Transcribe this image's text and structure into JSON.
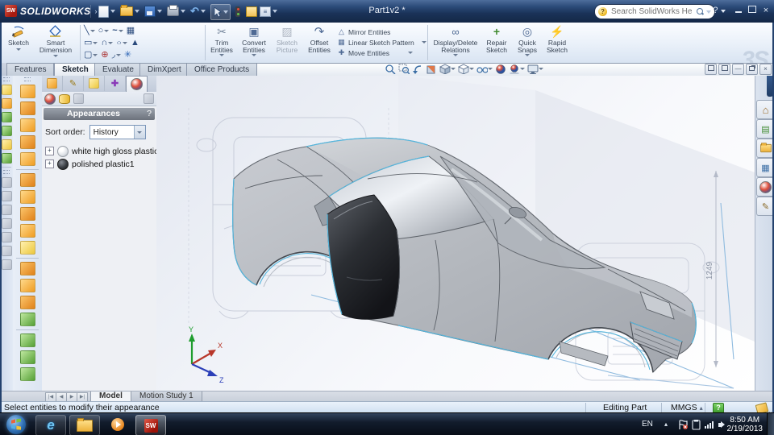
{
  "titlebar": {
    "logo_glyph": "SW",
    "brand": "SOLIDWORKS",
    "flyout_glyph": "›",
    "title": "Part1v2 *",
    "search_placeholder": "Search SolidWorks Help",
    "search_ball_glyph": "?",
    "help_glyph": "?",
    "close_glyph": "×"
  },
  "quick_access": {
    "icons": [
      "new-document",
      "open",
      "save",
      "print",
      "undo",
      "select",
      "rebuild-traffic-light",
      "file-properties",
      "options"
    ]
  },
  "ribbon": {
    "sketch": "Sketch",
    "smart_dimension": "Smart Dimension",
    "trim": "Trim Entities",
    "convert": "Convert Entities",
    "sketch_picture": "Sketch Picture",
    "offset": "Offset Entities",
    "mirror": "Mirror Entities",
    "linear_pattern": "Linear Sketch Pattern",
    "move": "Move Entities",
    "display_delete": "Display/Delete Relations",
    "repair": "Repair Sketch",
    "quick_snaps": "Quick Snaps",
    "rapid": "Rapid Sketch",
    "watermark": "3S",
    "sketch_tools": [
      {
        "name": "line",
        "glyph": "╲"
      },
      {
        "name": "circle",
        "glyph": "○"
      },
      {
        "name": "spline",
        "glyph": "~"
      },
      {
        "name": "spline-grid",
        "glyph": "▦"
      },
      {
        "name": "corner-rectangle",
        "glyph": "▭"
      },
      {
        "name": "centerpoint-arc",
        "glyph": "∩"
      },
      {
        "name": "ellipse",
        "glyph": "○"
      },
      {
        "name": "polygon",
        "glyph": "▲"
      },
      {
        "name": "straight-slot",
        "glyph": "▢"
      },
      {
        "name": "point",
        "glyph": "⊕"
      },
      {
        "name": "sketch-fillet",
        "glyph": "◞"
      },
      {
        "name": "pattern-star",
        "glyph": "✳"
      }
    ],
    "glyphs": {
      "trim": "✂",
      "convert": "▣",
      "picture": "▨",
      "offset": "↷",
      "mirror": "△",
      "linear": "▦",
      "move": "✚",
      "display": "∞",
      "repair": "+",
      "snaps": "◎",
      "rapid": "⚡"
    }
  },
  "command_tabs": {
    "tabs": [
      {
        "label": "Features",
        "active": false
      },
      {
        "label": "Sketch",
        "active": true
      },
      {
        "label": "Evaluate",
        "active": false
      },
      {
        "label": "DimXpert",
        "active": false
      },
      {
        "label": "Office Products",
        "active": false
      }
    ]
  },
  "headsup": {
    "icons": [
      "zoom-to-fit",
      "zoom-to-area",
      "zoom-previous",
      "section-view",
      "view-orientation",
      "display-style",
      "hide-show-items",
      "edit-appearance",
      "apply-scene",
      "view-settings"
    ]
  },
  "panel": {
    "tabs": [
      "feature-manager",
      "property-manager",
      "configuration-manager",
      "dimxpert-manager",
      "display-manager"
    ],
    "tab_glyphs": {
      "property": "✎",
      "dimxpert": "✚"
    },
    "subtoolbar": [
      "appearances-filter",
      "scenes-filter",
      "decals-filter",
      "options-stack"
    ],
    "header": "Appearances",
    "help_glyph": "?",
    "sort_label": "Sort order:",
    "sort_value": "History",
    "tree": [
      {
        "label": "white high gloss plastic",
        "sphere": "white",
        "expander": "+"
      },
      {
        "label": "polished plastic1",
        "sphere": "dark",
        "expander": "+"
      }
    ]
  },
  "taskpane": {
    "tabs": [
      "solidworks-resources",
      "design-library",
      "file-explorer",
      "view-palette",
      "appearances-scenes",
      "custom-properties"
    ],
    "home_glyph": "⌂",
    "palette_glyph": "▦",
    "props_glyph": "✎",
    "library_glyph": "▤"
  },
  "viewport": {
    "dimension_label": "1249",
    "triad": {
      "x": "X",
      "y": "Y",
      "z": "Z"
    }
  },
  "bottom": {
    "nav": [
      "|◀",
      "◀",
      "▶",
      "▶|"
    ],
    "tabs": [
      {
        "label": "Model",
        "active": true
      },
      {
        "label": "Motion Study 1",
        "active": false
      }
    ]
  },
  "statusbar": {
    "message": "Select entities to modify their appearance",
    "editing_mode": "Editing Part",
    "units": "MMGS",
    "units_caret": "▴",
    "help_glyph": "?"
  },
  "taskbar": {
    "apps": [
      "start-orb",
      "internet-explorer",
      "windows-explorer",
      "media-player",
      "solidworks"
    ],
    "ie_glyph": "e",
    "sw_glyph": "SW",
    "tray": {
      "lang": "EN",
      "hidden_icons_caret": "▴",
      "icons": [
        "action-center-flag",
        "gadget-clipboard",
        "network-signal",
        "volume-speaker"
      ],
      "time": "8:50 AM",
      "date": "2/19/2013"
    }
  }
}
